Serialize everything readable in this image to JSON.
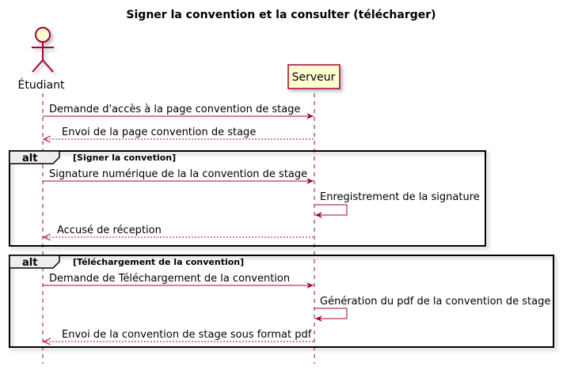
{
  "title": "Signer la convention et la consulter (télécharger)",
  "participants": {
    "student": "Étudiant",
    "server": "Serveur"
  },
  "frames": [
    {
      "keyword": "alt",
      "guard": "[Signer la convetion]",
      "messages": [
        "Signature numérique de la la convention de stage",
        "Enregistrement de la signature",
        "Accusé de réception"
      ]
    },
    {
      "keyword": "alt",
      "guard": "[Téléchargement de la convention]",
      "messages": [
        "Demande de Téléchargement de la convention",
        "Génération du pdf de la convention de stage",
        "Envoi de la convention de stage sous format pdf"
      ]
    }
  ],
  "pre_messages": [
    "Demande d'accès à la page convention de stage",
    "Envoi de la page convention de stage"
  ],
  "colors": {
    "line": "#A80036",
    "participant_fill": "#FEFECE",
    "frame_label_fill": "#EEEEEE"
  }
}
